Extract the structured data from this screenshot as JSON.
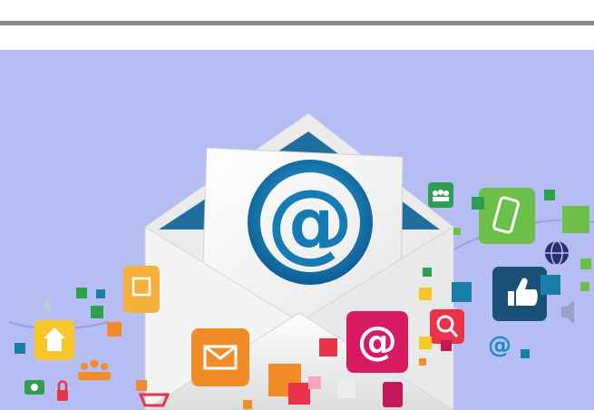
{
  "page": {
    "background": "#ffffff",
    "rule_color": "#8a8a8a"
  },
  "illustration": {
    "background": "#b5bdf2",
    "envelope_color": "#f1f1f1",
    "envelope_inner_color": "#1f6e9e",
    "main_symbol": "@",
    "badge_at_symbol": "@",
    "small_at_symbol": "@",
    "icons": [
      "email-envelope-icon",
      "at-sign-icon",
      "mail-icon",
      "search-icon",
      "mobile-phone-icon",
      "thumbs-up-icon",
      "globe-icon",
      "users-icon",
      "home-icon",
      "shopping-cart-icon",
      "camera-icon",
      "lock-icon",
      "people-icon",
      "star-icon",
      "speaker-icon"
    ],
    "accent_colors": {
      "green": "#6cc04a",
      "orange": "#f28c28",
      "red": "#e8334a",
      "crimson": "#c2185b",
      "teal": "#1a7fa8",
      "yellow": "#f7c72a",
      "at_blue": "#1b8bc5"
    }
  }
}
